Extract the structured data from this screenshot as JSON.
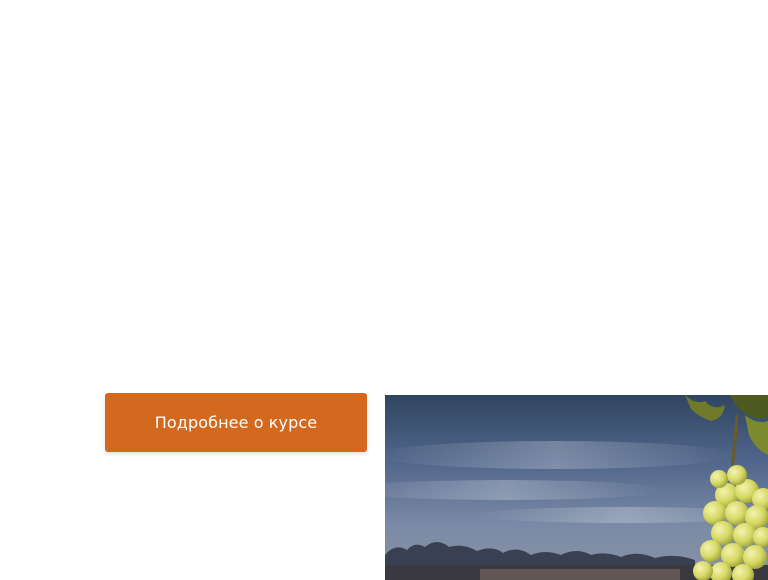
{
  "cta": {
    "label": "Подробнее о курсе",
    "color": "#d2691e"
  },
  "hero_image": {
    "subject": "vineyard-grapes-photo"
  },
  "colors": {
    "sky_top": "#3b4f6a",
    "sky_mid": "#6a7d98",
    "grape_green": "#d7dc6a"
  }
}
